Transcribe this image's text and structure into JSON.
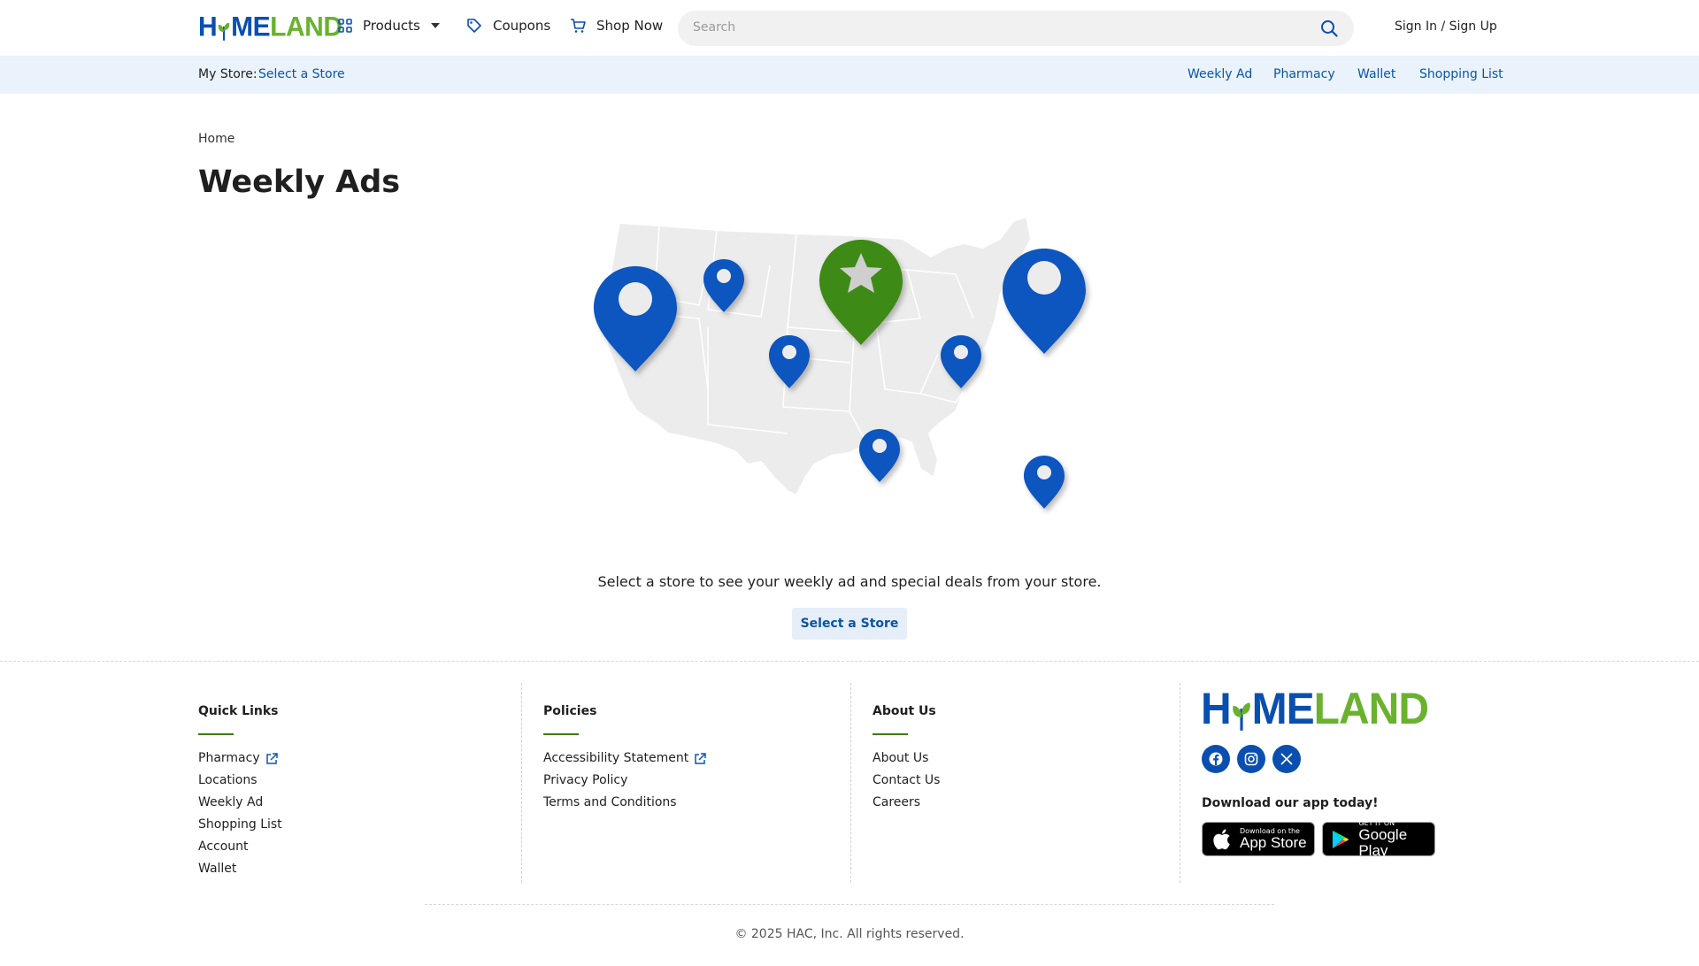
{
  "header": {
    "logo_left": "H",
    "logo_mid": "ME",
    "logo_right": "LAND",
    "nav": [
      {
        "label": "Products",
        "icon": "grid-icon"
      },
      {
        "label": "Coupons",
        "icon": "tag-icon"
      },
      {
        "label": "Shop Now",
        "icon": "cart-icon"
      }
    ],
    "search_placeholder": "Search",
    "signin": "Sign In / Sign Up"
  },
  "storebar": {
    "my_store_label": "My Store:",
    "my_store_link": "Select a Store",
    "links": [
      "Weekly Ad",
      "Pharmacy",
      "Wallet",
      "Shopping List"
    ]
  },
  "main": {
    "breadcrumb": "Home",
    "title": "Weekly Ads",
    "prompt": "Select a store to see your weekly ad and special deals from your store.",
    "button": "Select a Store"
  },
  "footer": {
    "quick_links": {
      "title": "Quick Links",
      "items": [
        "Pharmacy",
        "Locations",
        "Weekly Ad",
        "Shopping List",
        "Account",
        "Wallet"
      ]
    },
    "policies": {
      "title": "Policies",
      "items": [
        "Accessibility Statement",
        "Privacy Policy",
        "Terms and Conditions"
      ]
    },
    "about": {
      "title": "About Us",
      "items": [
        "About Us",
        "Contact Us",
        "Careers"
      ]
    },
    "app_title": "Download our app today!",
    "app_store": {
      "small": "Download on the",
      "big": "App Store"
    },
    "google_play": {
      "small": "GET IT ON",
      "big": "Google Play"
    },
    "copyright": "© 2025 HAC, Inc. All rights reserved."
  },
  "colors": {
    "brand_blue": "#0a4fb0",
    "brand_green": "#6ab22e",
    "link_blue": "#0a55a6",
    "pin_green": "#3e8a12",
    "store_bar_bg": "#eaf2fb"
  }
}
